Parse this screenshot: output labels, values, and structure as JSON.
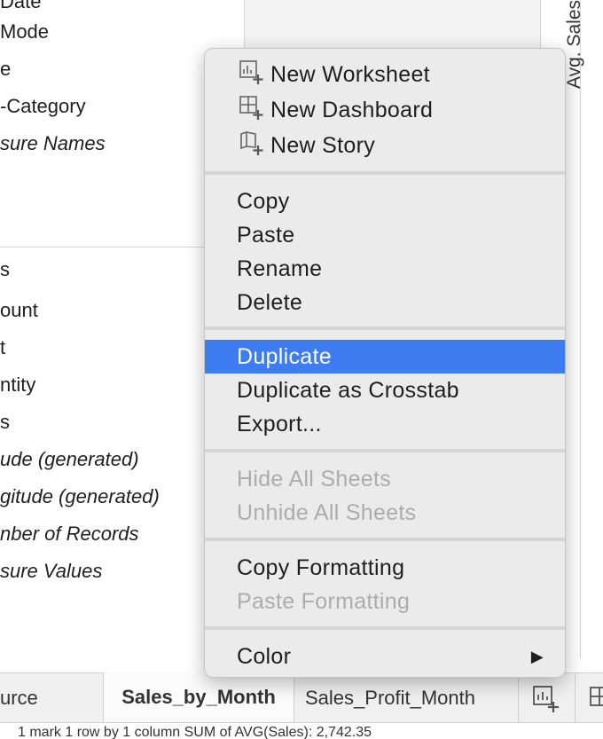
{
  "fields": [
    {
      "label": " Date",
      "italic": false
    },
    {
      "label": " Mode",
      "italic": false
    },
    {
      "label": "e",
      "italic": false
    },
    {
      "label": "-Category",
      "italic": false
    },
    {
      "label": "sure Names",
      "italic": true
    },
    {
      "label": "s",
      "italic": false
    },
    {
      "label": "ount",
      "italic": false
    },
    {
      "label": "t",
      "italic": false
    },
    {
      "label": "ntity",
      "italic": false
    },
    {
      "label": "s",
      "italic": false
    },
    {
      "label": "ude (generated)",
      "italic": true
    },
    {
      "label": "gitude (generated)",
      "italic": true
    },
    {
      "label": "nber of Records",
      "italic": true
    },
    {
      "label": "sure Values",
      "italic": true
    }
  ],
  "axis_label": "Avg. Sales",
  "menu": {
    "new_worksheet": "New Worksheet",
    "new_dashboard": "New Dashboard",
    "new_story": "New Story",
    "copy": "Copy",
    "paste": "Paste",
    "rename": "Rename",
    "delete": "Delete",
    "duplicate": "Duplicate",
    "duplicate_crosstab": "Duplicate as Crosstab",
    "export": "Export...",
    "hide_all": "Hide All Sheets",
    "unhide_all": "Unhide All Sheets",
    "copy_formatting": "Copy Formatting",
    "paste_formatting": "Paste Formatting",
    "color": "Color",
    "submenu_arrow": "▶",
    "highlight_color": "#3d7cf1"
  },
  "tabs": {
    "source": "urce",
    "active": "Sales_by_Month",
    "other": "Sales_Profit_Month"
  },
  "status": "1 mark   1 row by 1 column   SUM of AVG(Sales): 2,742.35"
}
